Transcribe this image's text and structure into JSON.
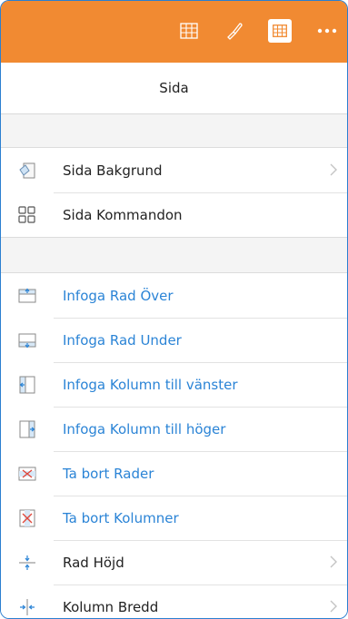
{
  "header": {
    "title": "Sida"
  },
  "toolbar": {
    "icons": [
      "table-grid-icon",
      "brush-icon",
      "table-icon",
      "more-icon"
    ],
    "more_label": "•••"
  },
  "groups": {
    "page": [
      {
        "label": "Sida Bakgrund",
        "icon": "page-background-icon",
        "chevron": true
      },
      {
        "label": "Sida Kommandon",
        "icon": "grid-commands-icon",
        "chevron": false
      }
    ],
    "table": [
      {
        "label": "Infoga Rad Över",
        "icon": "insert-row-above-icon"
      },
      {
        "label": "Infoga Rad Under",
        "icon": "insert-row-below-icon"
      },
      {
        "label": "Infoga Kolumn till vänster",
        "icon": "insert-column-left-icon"
      },
      {
        "label": "Infoga Kolumn till höger",
        "icon": "insert-column-right-icon"
      },
      {
        "label": "Ta bort Rader",
        "icon": "delete-rows-icon"
      },
      {
        "label": "Ta bort Kolumner",
        "icon": "delete-columns-icon"
      },
      {
        "label": "Rad Höjd",
        "icon": "row-height-icon",
        "chevron": true
      },
      {
        "label": "Kolumn Bredd",
        "icon": "column-width-icon",
        "chevron": true
      }
    ]
  },
  "colors": {
    "topbar": "#f18a32",
    "link_blue": "#2b84d6",
    "frame_border": "#2b7fd0"
  }
}
